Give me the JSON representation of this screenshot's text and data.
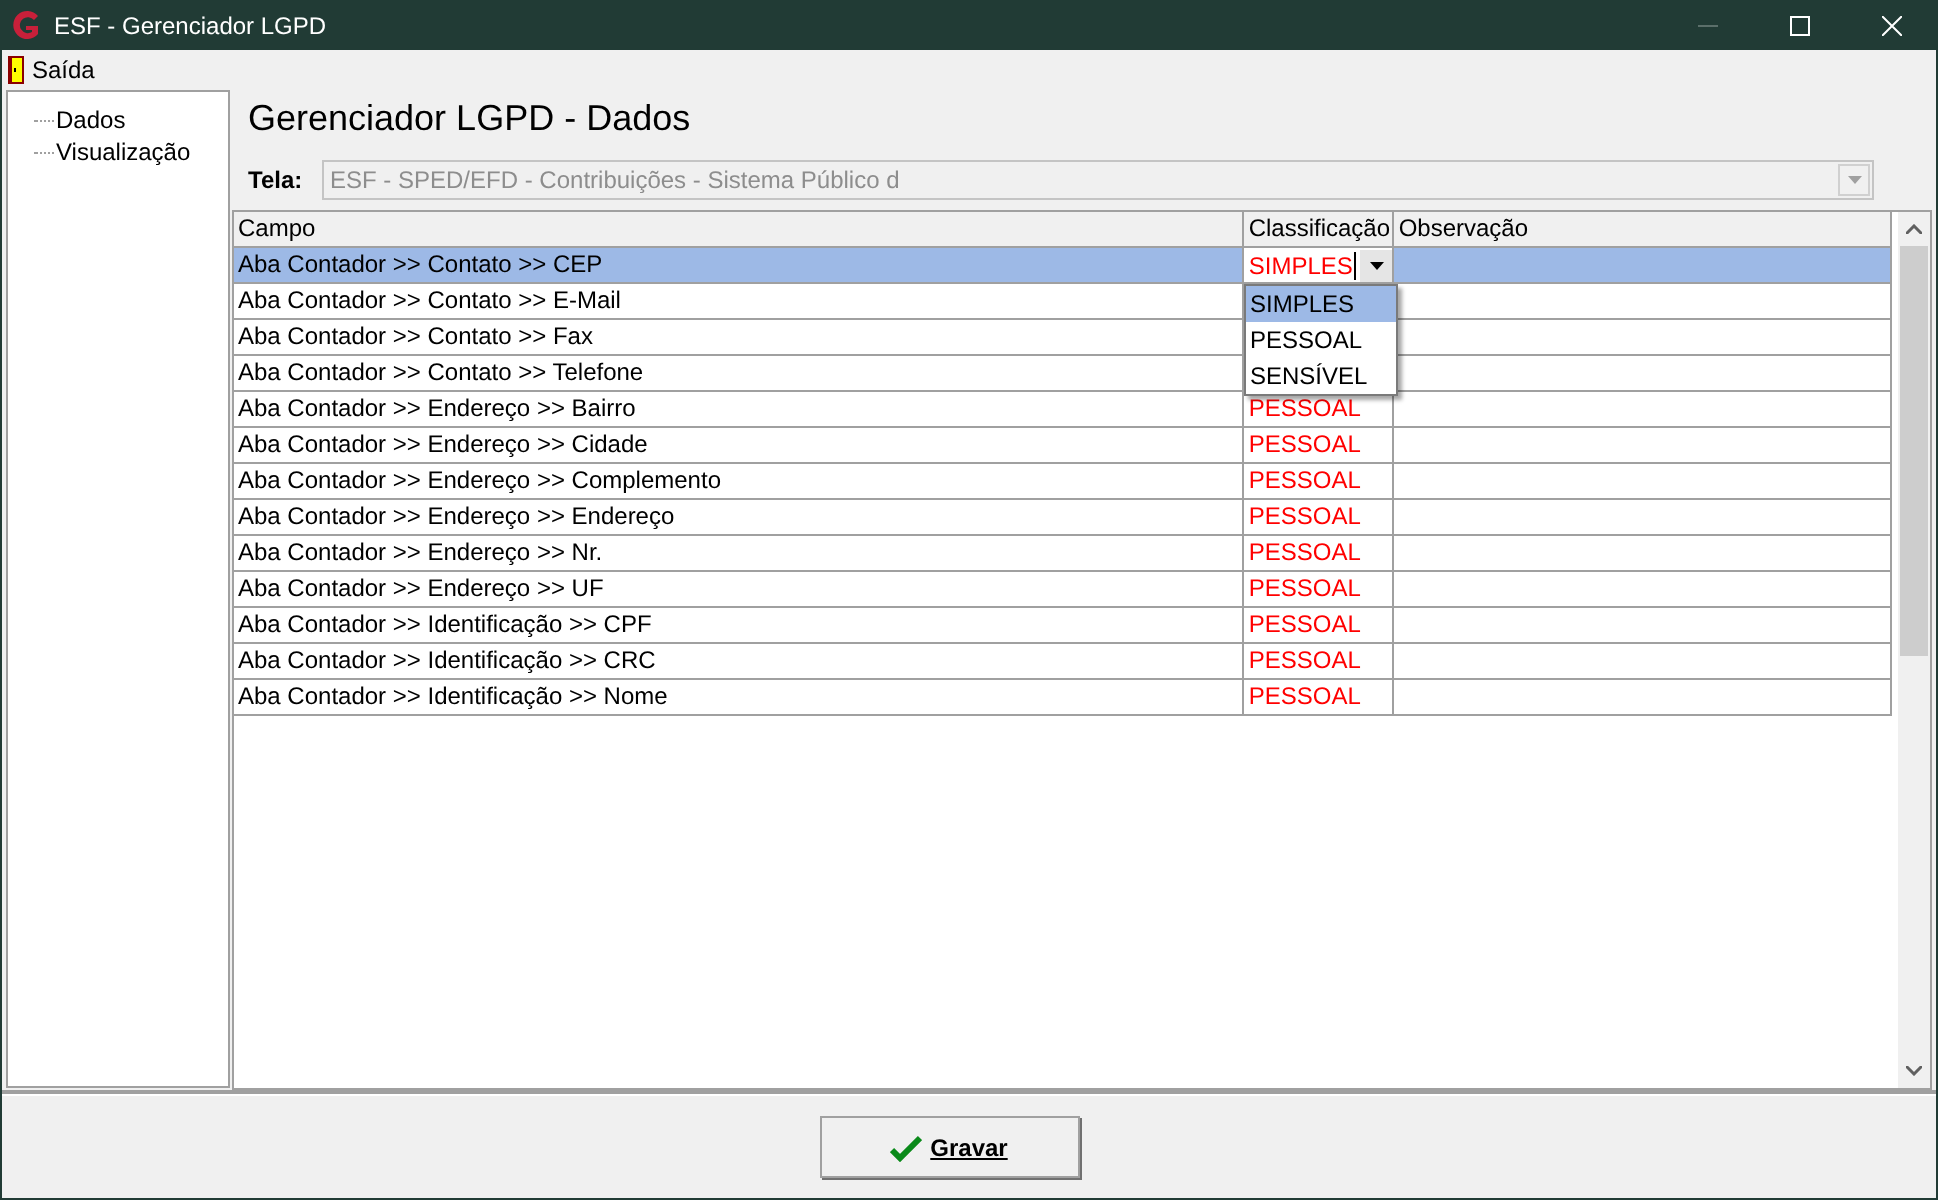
{
  "window": {
    "title": "ESF - Gerenciador LGPD"
  },
  "menu": [
    {
      "label": "Saída"
    }
  ],
  "tree": [
    {
      "label": "Dados"
    },
    {
      "label": "Visualização"
    }
  ],
  "heading": "Gerenciador LGPD - Dados",
  "tela": {
    "label": "Tela:",
    "value": "ESF - SPED/EFD - Contribuições - Sistema Público d",
    "disabled": true
  },
  "table": {
    "columns": [
      "Campo",
      "Classificação",
      "Observação"
    ],
    "rows": [
      {
        "campo": "Aba Contador >> Contato >> CEP",
        "classificacao": "SIMPLES",
        "selected": true,
        "editing": true
      },
      {
        "campo": "Aba Contador >> Contato >> E-Mail",
        "selected": false
      },
      {
        "campo": "Aba Contador >> Contato >> Fax",
        "selected": false
      },
      {
        "campo": "Aba Contador >> Contato >> Telefone",
        "selected": false
      },
      {
        "campo": "Aba Contador >> Endereço >> Bairro",
        "classificacao": "PESSOAL",
        "selected": false
      },
      {
        "campo": "Aba Contador >> Endereço >> Cidade",
        "classificacao": "PESSOAL",
        "selected": false
      },
      {
        "campo": "Aba Contador >> Endereço >> Complemento",
        "classificacao": "PESSOAL",
        "selected": false
      },
      {
        "campo": "Aba Contador >> Endereço >> Endereço",
        "classificacao": "PESSOAL",
        "selected": false
      },
      {
        "campo": "Aba Contador >> Endereço >> Nr.",
        "classificacao": "PESSOAL",
        "selected": false
      },
      {
        "campo": "Aba Contador >> Endereço >> UF",
        "classificacao": "PESSOAL",
        "selected": false
      },
      {
        "campo": "Aba Contador >> Identificação >> CPF",
        "classificacao": "PESSOAL",
        "selected": false
      },
      {
        "campo": "Aba Contador >> Identificação >> CRC",
        "classificacao": "PESSOAL",
        "selected": false
      },
      {
        "campo": "Aba Contador >> Identificação >> Nome",
        "classificacao": "PESSOAL",
        "selected": false
      }
    ]
  },
  "dropdown": [
    {
      "label": "SIMPLES",
      "selected": true
    },
    {
      "label": "PESSOAL",
      "selected": false
    },
    {
      "label": "SENSÍVEL",
      "selected": false
    }
  ],
  "button": {
    "label": "Gravar"
  }
}
